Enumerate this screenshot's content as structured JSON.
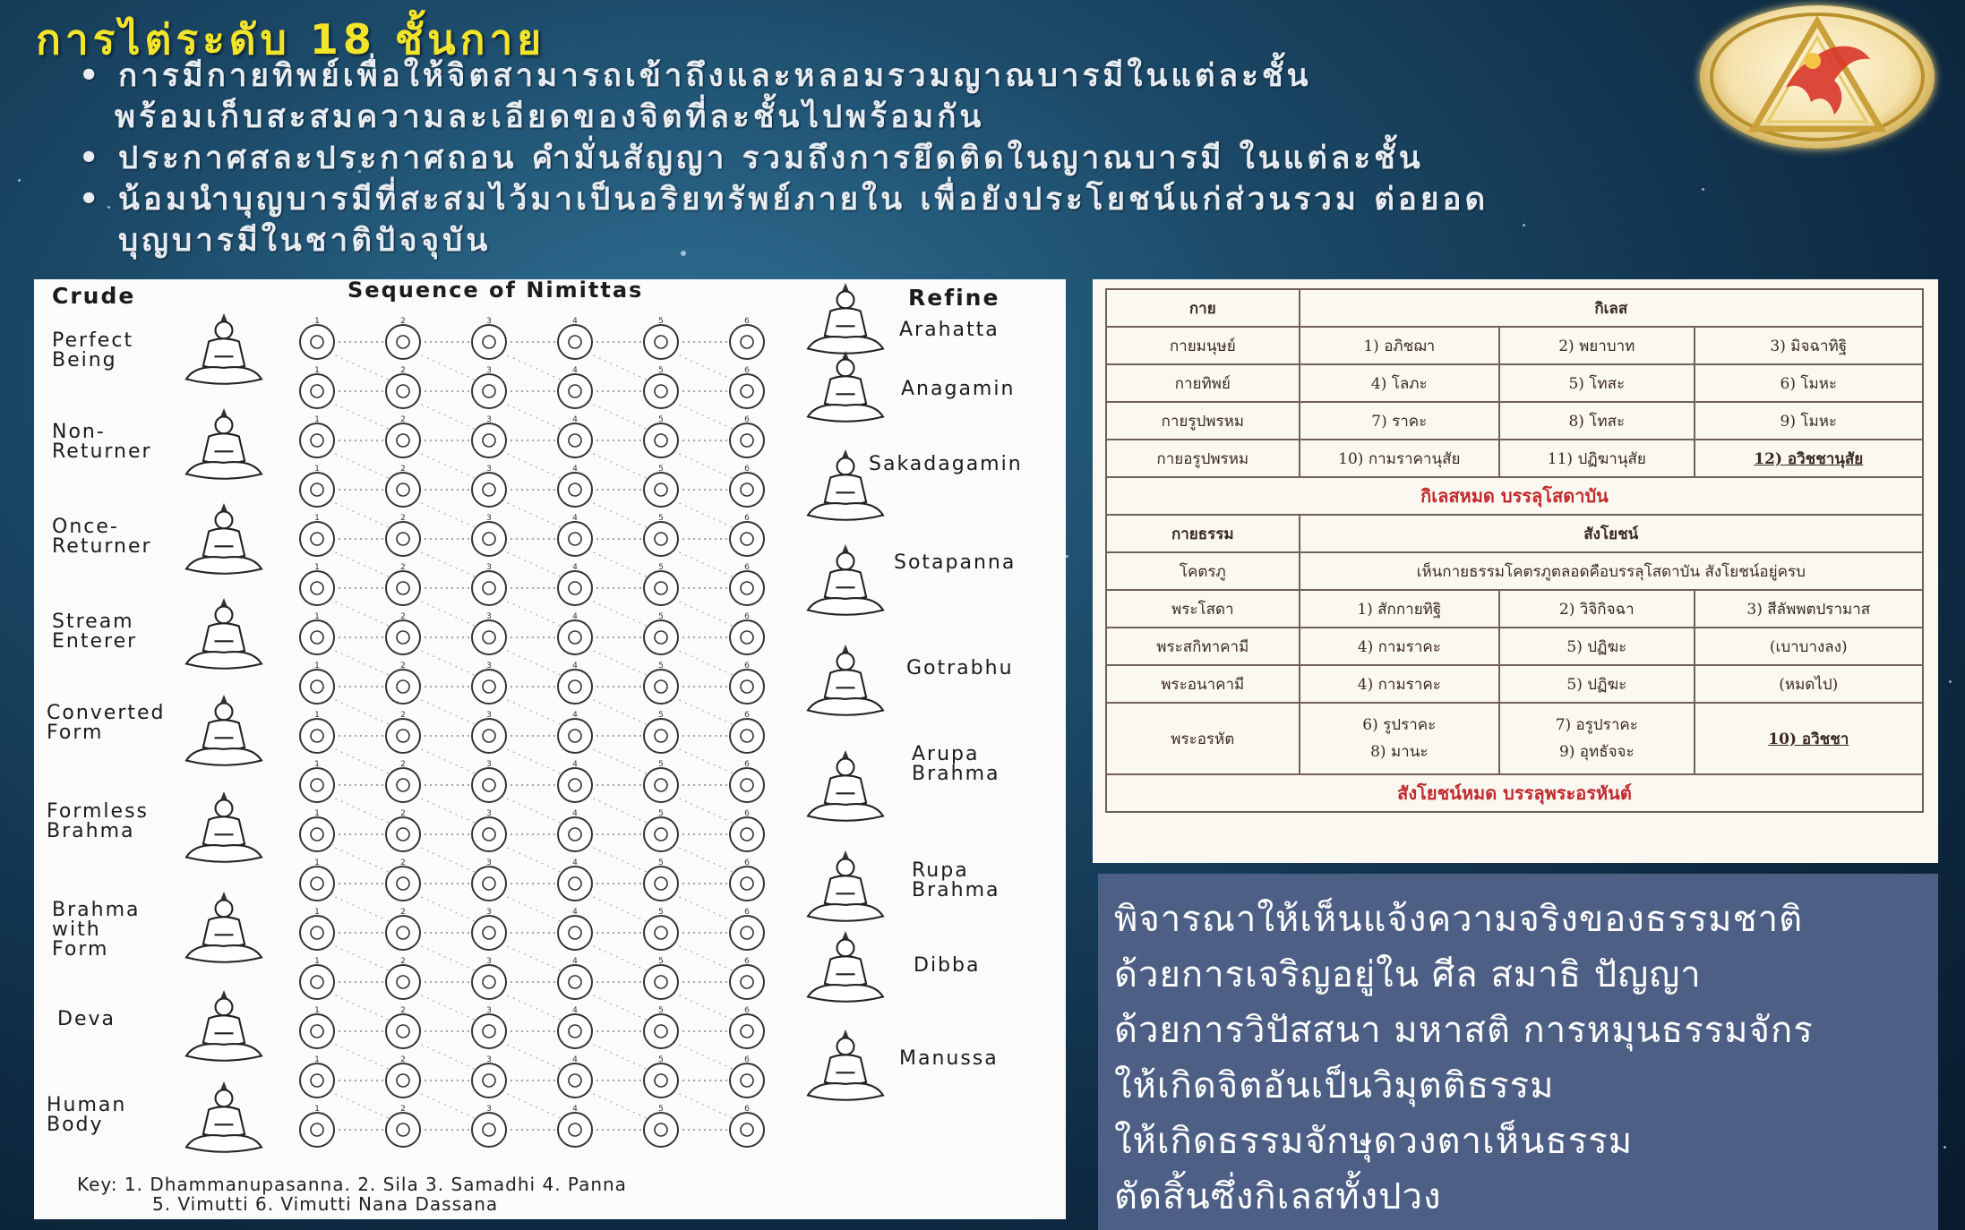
{
  "title": "การไต่ระดับ 18 ชั้นกาย",
  "bullets": [
    "การมีกายทิพย์เพื่อให้จิตสามารถเข้าถึงและหลอมรวมญาณบารมีในแต่ละชั้น",
    "พร้อมเก็บสะสมความละเอียดของจิตที่ละชั้นไปพร้อมกัน",
    "ประกาศสละประกาศถอน คำมั่นสัญญา รวมถึงการยึดติดในญาณบารมี ในแต่ละชั้น",
    "น้อมนำบุญบารมีที่สะสมไว้มาเป็นอริยทรัพย์ภายใน เพื่อยังประโยชน์แก่ส่วนรวม ต่อยอด",
    "บุญบารมีในชาติปัจจุบัน"
  ],
  "logo": {
    "icon": "garuda-triangle-emblem",
    "color": "#d3a83a"
  },
  "diagram": {
    "header_left": "Crude",
    "header_center": "Sequence of Nimittas",
    "header_right": "Refine",
    "left_labels": [
      "Perfect\nBeing",
      "Non-\nReturner",
      "Once-\nReturner",
      "Stream\nEnterer",
      "Converted\nForm",
      "Formless\nBrahma",
      "Brahma\nwith\nForm",
      "Deva",
      "Human\nBody"
    ],
    "right_labels": [
      "Arahatta",
      "Anagamin",
      "Sakadagamin",
      "Sotapanna",
      "Gotrabhu",
      "Arupa\nBrahma",
      "Rupa\nBrahma",
      "Dibba",
      "Manussa"
    ],
    "rows": 17,
    "cols": 6,
    "key_line1": "Key: 1. Dhammanupasanna. 2. Sila 3. Samadhi 4. Panna",
    "key_line2": "5. Vimutti 6. Vimutti Nana Dassana",
    "figure_icon": "seated-buddha-icon"
  },
  "kaya_table": {
    "h_kaya": "กาย",
    "h_kilesa": "กิเลส",
    "rows1": [
      [
        "กายมนุษย์",
        "1) อภิชฌา",
        "2) พยาบาท",
        "3) มิจฉาทิฐิ"
      ],
      [
        "กายทิพย์",
        "4) โลภะ",
        "5) โทสะ",
        "6) โมหะ"
      ],
      [
        "กายรูปพรหม",
        "7) ราคะ",
        "8) โทสะ",
        "9) โมหะ"
      ],
      [
        "กายอรูปพรหม",
        "10) กามราคานุสัย",
        "11) ปฏิฆานุสัย",
        "12) อวิชชานุสัย"
      ]
    ],
    "summary1": "กิเลสหมด บรรลุโสดาบัน",
    "h_dhamma": "กายธรรม",
    "h_samyojana": "สังโยชน์",
    "gotrabhu_label": "โคตรภู",
    "gotrabhu_text": "เห็นกายธรรมโคตรภูตลอดคือบรรลุโสดาบัน สังโยชน์อยู่ครบ",
    "rows2": [
      [
        "พระโสดา",
        "1) สักกายทิฐิ",
        "2) วิจิกิจฉา",
        "3) สีลัพพตปรามาส"
      ],
      [
        "พระสกิทาคามี",
        "4) กามราคะ",
        "5) ปฏิฆะ",
        "(เบาบางลง)"
      ],
      [
        "พระอนาคามี",
        "4) กามราคะ",
        "5) ปฏิฆะ",
        "(หมดไป)"
      ]
    ],
    "arahant_label": "พระอรหัต",
    "arahant_c1a": "6) รูปราคะ",
    "arahant_c1b": "8) มานะ",
    "arahant_c2a": "7) อรูปราคะ",
    "arahant_c2b": "9) อุทธัจจะ",
    "arahant_c3": "10) อวิชชา",
    "summary2": "สังโยชน์หมด บรรลุพระอรหันต์"
  },
  "text_box": [
    "พิจารณาให้เห็นแจ้งความจริงของธรรมชาติ",
    "ด้วยการเจริญอยู่ใน ศีล สมาธิ ปัญญา",
    "ด้วยการวิปัสสนา มหาสติ การหมุนธรรมจักร",
    "ให้เกิดจิตอันเป็นวิมุตติธรรม",
    "ให้เกิดธรรมจักษุดวงตาเห็นธรรม",
    "ตัดสิ้นซึ่งกิเลสทั้งปวง"
  ],
  "colors": {
    "title": "#f2e32b",
    "panel_bg": "#4d5f85",
    "table_red": "#c3282c"
  }
}
